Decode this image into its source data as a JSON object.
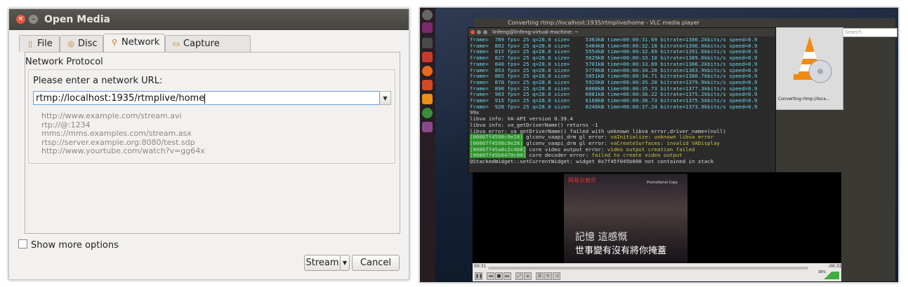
{
  "dialog": {
    "title": "Open Media",
    "tabs": [
      {
        "label": "File",
        "icon": "file-icon"
      },
      {
        "label": "Disc",
        "icon": "disc-icon"
      },
      {
        "label": "Network",
        "icon": "network-icon"
      },
      {
        "label": "Capture Device",
        "icon": "capture-device-icon"
      }
    ],
    "section_title": "Network Protocol",
    "url_prompt": "Please enter a network URL:",
    "url_value": "rtmp://localhost:1935/rtmplive/home",
    "examples": [
      "http://www.example.com/stream.avi",
      "rtp://@:1234",
      "mms://mms.examples.com/stream.asx",
      "rtsp://server.example.org:8080/test.sdp",
      "http://www.yourtube.com/watch?v=gg64x"
    ],
    "show_more_label": "Show more options",
    "stream_button": "Stream",
    "cancel_button": "Cancel"
  },
  "desktop": {
    "vlc_title": "Converting rtmp://localhost:1935/rtmplive/home - VLC media player",
    "search_placeholder": "Search",
    "thumb_caption": "Converting rtmp://loca...",
    "terminal_title": "linfeng@linfeng-virtual-machine: ~",
    "terminal_lines": [
      "frame=  789 fps= 25 q=28.0 size=     5363kB time=00:00:31.69 bitrate=1386.2kbits/s speed=0.9",
      "frame=  802 fps= 25 q=28.0 size=     5484kB time=00:00:32.18 bitrate=1396.0kbits/s speed=0.9",
      "frame=  815 fps= 25 q=28.0 size=     5554kB time=00:00:32.69 bitrate=1391.6kbits/s speed=0.9",
      "frame=  827 fps= 25 q=28.0 size=     5629kB time=00:00:33.18 bitrate=1389.6kbits/s speed=0.9",
      "frame=  840 fps= 25 q=28.0 size=     5701kB time=00:00:33.69 bitrate=1386.2kbits/s speed=0.9",
      "frame=  853 fps= 25 q=28.0 size=     5778kB time=00:00:34.20 bitrate=1383.9kbits/s speed=0.9",
      "frame=  865 fps= 25 q=28.0 size=     5851kB time=00:00:34.71 bitrate=1380.7kbits/s speed=0.9",
      "frame=  878 fps= 25 q=28.0 size=     5929kB time=00:00:35.20 bitrate=1379.9kbits/s speed=0.9",
      "frame=  890 fps= 25 q=28.0 size=     6008kB time=00:00:35.73 bitrate=1377.3kbits/s speed=0.9",
      "frame=  903 fps= 25 q=28.0 size=     6081kB time=00:00:36.22 bitrate=1375.2kbits/s speed=0.9",
      "frame=  915 fps= 25 q=28.0 size=     6168kB time=00:00:36.73 bitrate=1375.5kbits/s speed=0.9",
      "frame=  928 fps= 25 q=28.0 size=     6246kB time=00:00:37.24 bitrate=1373.9kbits/s speed=0.9",
      "99x",
      "libva info: VA-API version 0.39.4",
      "libva info: va_getDriverName() returns -1",
      "libva error: va_getDriverName() failed with unknown libva error,driver_name=(null)"
    ],
    "terminal_errors": [
      {
        "addr": "[00007f4598c9e28]",
        "text": " glconv_vaapi_drm gl error: ",
        "warn": "vaInitialize: unknown libva error"
      },
      {
        "addr": "[00007f4598c9e28]",
        "text": " glconv_vaapi_drm gl error: ",
        "warn": "vaCreateSurfaces: invalid VADisplay"
      },
      {
        "addr": "[00007f45a8c2c468]",
        "text": " core video output error: ",
        "warn": "video output creation failed"
      },
      {
        "addr": "[00007f45b0470c00]",
        "text": " core decoder error: ",
        "warn": "failed to create video output"
      }
    ],
    "terminal_tail": "QStackedWidget::setCurrentWidget: widget 0x7f45f045b000 not contained in stack",
    "video_logo": "网易云音乐",
    "video_promo": "Promotional Copy",
    "subtitle_line1": "記憶 這感慨",
    "subtitle_line2": "世事變有沒有將你掩蓋",
    "time_elapsed": "00:31",
    "time_remaining": "-00:31",
    "volume": "38%",
    "colors": {
      "dialog_title_bg": "#4e4d48",
      "desktop_bg": "#142236",
      "accent": "#e8553b"
    }
  }
}
